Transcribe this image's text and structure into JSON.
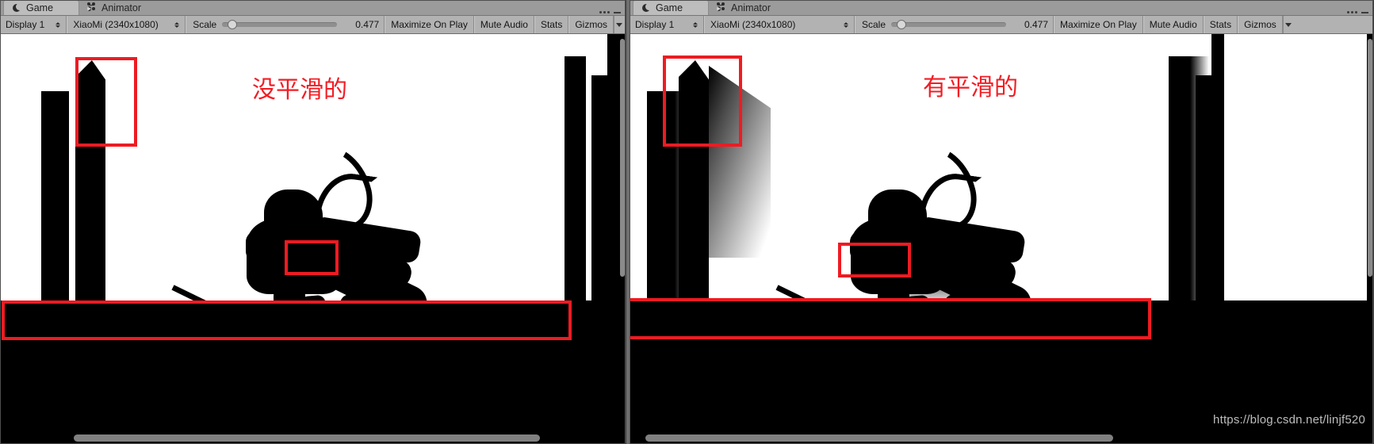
{
  "window": {
    "divider_color": "#6f6f6f",
    "accent_red": "#ee1b22"
  },
  "panels": [
    {
      "id": "left",
      "tabs": [
        {
          "label": "Game",
          "icon": "game-crescent-icon",
          "active": true
        },
        {
          "label": "Animator",
          "icon": "animator-nodes-icon",
          "active": false
        }
      ],
      "toolbar": {
        "display": "Display 1",
        "aspect": "XiaoMi (2340x1080)",
        "scale_label": "Scale",
        "scale_value": "0.477",
        "maximize": "Maximize On Play",
        "mute": "Mute Audio",
        "stats": "Stats",
        "gizmos": "Gizmos"
      },
      "annotation": "没平滑的",
      "shadow_mode": "hard"
    },
    {
      "id": "right",
      "tabs": [
        {
          "label": "Game",
          "icon": "game-crescent-icon",
          "active": true
        },
        {
          "label": "Animator",
          "icon": "animator-nodes-icon",
          "active": false
        }
      ],
      "toolbar": {
        "display": "Display 1",
        "aspect": "XiaoMi (2340x1080)",
        "scale_label": "Scale",
        "scale_value": "0.477",
        "maximize": "Maximize On Play",
        "mute": "Mute Audio",
        "stats": "Stats",
        "gizmos": "Gizmos"
      },
      "annotation": "有平滑的",
      "shadow_mode": "soft"
    }
  ],
  "watermark": "https://blog.csdn.net/linjf520"
}
